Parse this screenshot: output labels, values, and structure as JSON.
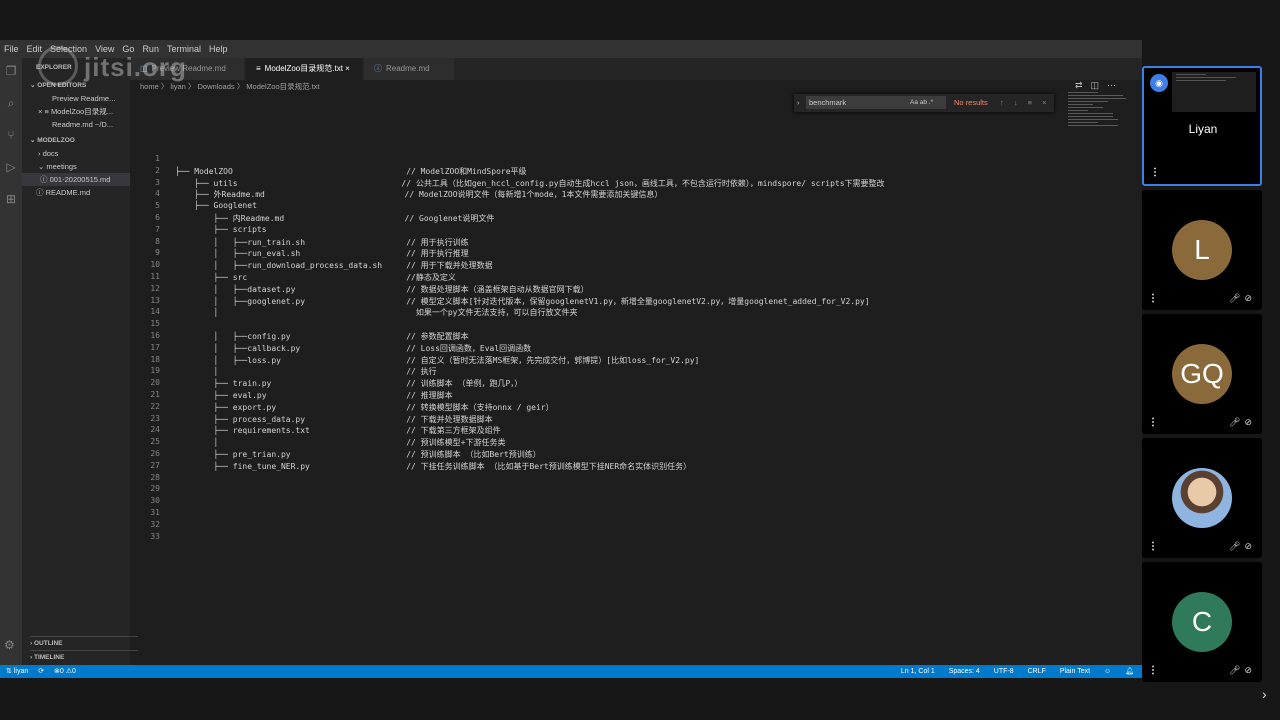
{
  "menu": [
    "File",
    "Edit",
    "Selection",
    "View",
    "Go",
    "Run",
    "Terminal",
    "Help"
  ],
  "watermark": "jitsi.org",
  "sidebar": {
    "explorer_label": "EXPLORER",
    "open_editors_label": "OPEN EDITORS",
    "open_editors": [
      "Preview Readme...",
      "ModelZoo目录规...",
      "Readme.md ~/D..."
    ],
    "folder_label": "MODELZOO",
    "tree": [
      "docs",
      "meetings",
      "001-20200515.md",
      "README.md"
    ],
    "outline_label": "OUTLINE",
    "timeline_label": "TIMELINE"
  },
  "tabs": [
    {
      "label": "Preview Readme.md",
      "active": false
    },
    {
      "label": "ModelZoo目录规范.txt",
      "active": true,
      "close": "×"
    },
    {
      "label": "Readme.md",
      "active": false
    }
  ],
  "breadcrumb": "home 〉 liyan 〉 Downloads 〉 ModelZoo目录规范.txt",
  "find": {
    "value": "benchmark",
    "options": "Aa  ab  .*",
    "result": "No results",
    "nav": "↑ ↓ ≡ ×"
  },
  "code_lines": [
    "",
    "├── ModelZOO                                    // ModelZOO和MindSpore平级",
    "    ├── utils                                  // 公共工具（比如gen_hccl_config.py自动生成hccl json，画线工具，不包含运行时依赖），mindspore/ scripts下需要整改",
    "    ├── 外Readme.md                             // ModelZOO说明文件（每新增1个mode，1本文件需要添加关键信息）",
    "    ├── Googlenet",
    "        ├── 内Readme.md                         // Googlenet说明文件",
    "        ├── scripts",
    "        │   ├──run_train.sh                     // 用于执行训练",
    "        │   ├──run_eval.sh                      // 用于执行推理",
    "        │   ├──run_download_process_data.sh     // 用于下载并处理数据",
    "        ├── src                                 //静态及定义",
    "        │   ├──dataset.py                       // 数据处理脚本（涵盖框架自动从数据官网下载）",
    "        │   ├──googlenet.py                     // 模型定义脚本[针对迭代版本，保留googlenetV1.py，新增全量googlenetV2.py，增量googlenet_added_for_V2.py]",
    "        │                                         如果一个py文件无法支持，可以自行放文件夹",
    "",
    "        │   ├──config.py                        // 参数配置脚本",
    "        │   ├──callback.py                      // Loss回调函数，Eval回调函数",
    "        │   ├──loss.py                          // 自定义（暂时无法落MS框架，先完成交付，郭博提）[比如loss_for_V2.py]",
    "        │                                       // 执行",
    "        ├── train.py                            // 训练脚本 （单例，跑几P，）",
    "        ├── eval.py                             // 推理脚本",
    "        ├── export.py                           // 转换模型脚本（支持onnx / geir）",
    "        ├── process_data.py                     // 下载并处理数据脚本",
    "        ├── requirements.txt                    // 下载第三方框架及组件",
    "        │                                       // 预训练模型+下游任务类",
    "        ├── pre_trian.py                        // 预训练脚本 （比如Bert预训练）",
    "        ├── fine_tune_NER.py                    // 下挂任务训练脚本 （比如基于Bert预训练模型下挂NER命名实体识别任务）",
    "",
    "",
    "",
    "",
    "",
    ""
  ],
  "status": {
    "branch": "liyan",
    "problems": "⊗0 ⚠0",
    "position": "Ln 1, Col 1",
    "spaces": "Spaces: 4",
    "encoding": "UTF-8",
    "eol": "CRLF",
    "language": "Plain Text"
  },
  "participants": [
    {
      "name": "Liyan",
      "initials": "",
      "kind": "screen",
      "active": true
    },
    {
      "name": "",
      "initials": "L",
      "color": "#8a6a3a"
    },
    {
      "name": "",
      "initials": "GQ",
      "color": "#8a6a3a"
    },
    {
      "name": "",
      "initials": "",
      "kind": "photo"
    },
    {
      "name": "",
      "initials": "C",
      "color": "#2e7a5a"
    }
  ]
}
